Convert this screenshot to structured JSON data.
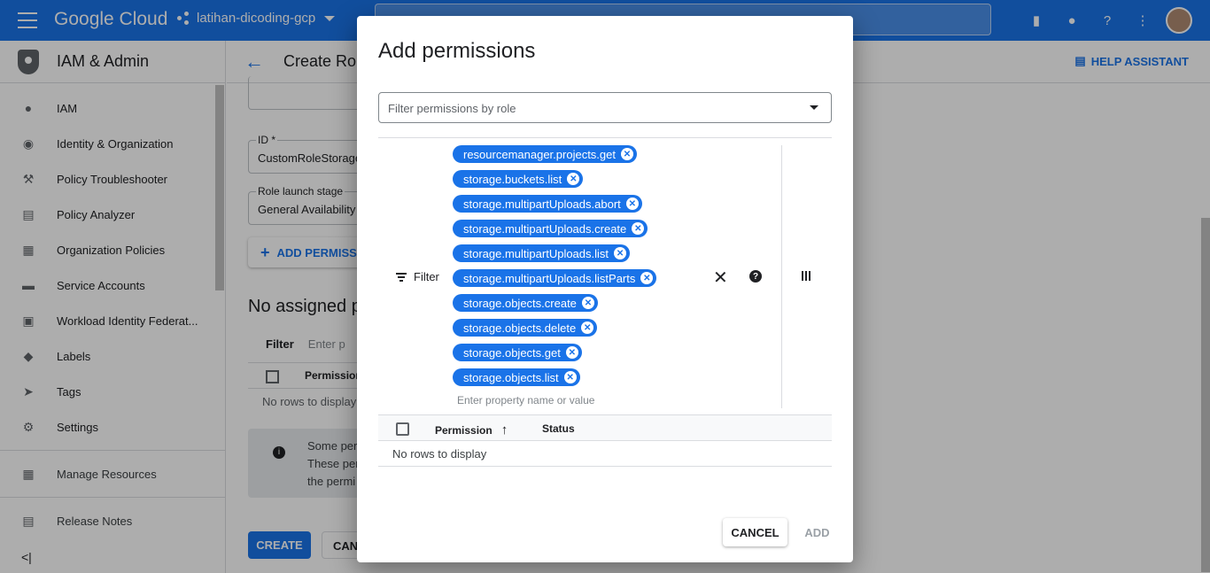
{
  "topbar": {
    "brand": "Google Cloud",
    "project": "latihan-dicoding-gcp"
  },
  "sidebar": {
    "title": "IAM & Admin",
    "items": [
      {
        "label": "IAM",
        "icon": "person-add-icon"
      },
      {
        "label": "Identity & Organization",
        "icon": "account-circle-icon"
      },
      {
        "label": "Policy Troubleshooter",
        "icon": "wrench-icon"
      },
      {
        "label": "Policy Analyzer",
        "icon": "document-search-icon"
      },
      {
        "label": "Organization Policies",
        "icon": "list-doc-icon"
      },
      {
        "label": "Service Accounts",
        "icon": "service-account-icon"
      },
      {
        "label": "Workload Identity Federat...",
        "icon": "id-card-icon"
      },
      {
        "label": "Labels",
        "icon": "label-icon"
      },
      {
        "label": "Tags",
        "icon": "tag-icon"
      },
      {
        "label": "Settings",
        "icon": "gear-icon"
      }
    ],
    "manage_resources": "Manage Resources",
    "release_notes": "Release Notes"
  },
  "main": {
    "title": "Create Rol",
    "help_assistant": "HELP ASSISTANT",
    "id_label": "ID *",
    "id_value": "CustomRoleStorage",
    "launch_label": "Role launch stage",
    "launch_value": "General Availability",
    "add_permissions": "ADD PERMISS",
    "no_assigned": "No assigned p",
    "filter": "Filter",
    "filter_enter": "Enter p",
    "permission_col": "Permission",
    "no_rows": "No rows to display",
    "info_lines": [
      "Some per",
      "These per",
      "the permi"
    ],
    "create": "CREATE",
    "cancel": "CANC"
  },
  "dialog": {
    "title": "Add permissions",
    "role_placeholder": "Filter permissions by role",
    "filter_label": "Filter",
    "chips": [
      "resourcemanager.projects.get",
      "storage.buckets.list",
      "storage.multipartUploads.abort",
      "storage.multipartUploads.create",
      "storage.multipartUploads.list",
      "storage.multipartUploads.listParts",
      "storage.objects.create",
      "storage.objects.delete",
      "storage.objects.get",
      "storage.objects.list"
    ],
    "property_placeholder": "Enter property name or value",
    "col_permission": "Permission",
    "col_status": "Status",
    "no_rows": "No rows to display",
    "cancel": "CANCEL",
    "add": "ADD"
  }
}
